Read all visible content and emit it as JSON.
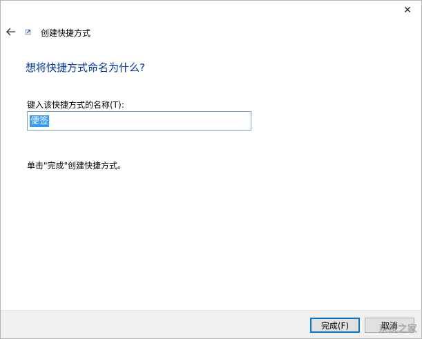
{
  "window": {
    "close_glyph": "✕"
  },
  "header": {
    "back_icon": "back-arrow-icon",
    "title": "创建快捷方式"
  },
  "main": {
    "heading": "想将快捷方式命名为什么?",
    "name_label": "键入该快捷方式的名称(T):",
    "name_value": "便签",
    "hint": "单击\"完成\"创建快捷方式。"
  },
  "footer": {
    "finish_label": "完成(F)",
    "cancel_label": "取消"
  },
  "watermark": {
    "text": "系统之家"
  },
  "colors": {
    "heading": "#003399",
    "selection": "#3399ff",
    "accent": "#0078d7"
  }
}
